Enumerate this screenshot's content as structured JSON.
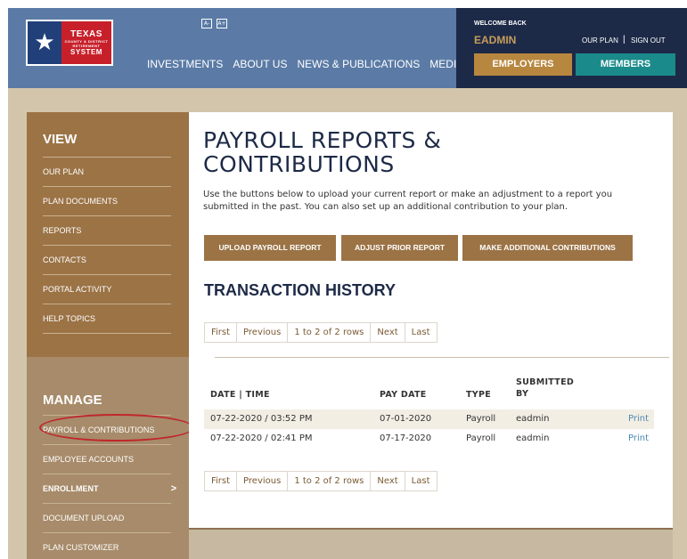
{
  "logo": {
    "line1": "TEXAS",
    "line2": "COUNTY & DISTRICT",
    "line3": "RETIREMENT",
    "line4": "SYSTEM",
    "star_icon": "star-icon"
  },
  "accessibility": {
    "decrease": "A-",
    "increase": "A+"
  },
  "nav": {
    "items": [
      "INVESTMENTS",
      "ABOUT US",
      "NEWS & PUBLICATIONS",
      "MEDIA"
    ]
  },
  "account": {
    "welcome": "WELCOME BACK",
    "username": "EADMIN",
    "our_plan": "OUR PLAN",
    "separator": "|",
    "sign_out": "SIGN OUT",
    "employers": "EMPLOYERS",
    "members": "MEMBERS"
  },
  "sidebar": {
    "view_heading": "VIEW",
    "view_items": [
      "OUR PLAN",
      "PLAN DOCUMENTS",
      "REPORTS",
      "CONTACTS",
      "PORTAL ACTIVITY",
      "HELP TOPICS"
    ],
    "manage_heading": "MANAGE",
    "manage_items": [
      "PAYROLL & CONTRIBUTIONS",
      "EMPLOYEE ACCOUNTS",
      "ENROLLMENT",
      "DOCUMENT UPLOAD",
      "PLAN CUSTOMIZER"
    ],
    "enrollment_chevron": ">"
  },
  "main": {
    "title": "PAYROLL REPORTS & CONTRIBUTIONS",
    "intro": "Use the buttons below to upload your current report or make an adjustment to a report you submitted in the past. You can also set up an additional contribution to your plan.",
    "buttons": [
      "UPLOAD PAYROLL REPORT",
      "ADJUST PRIOR REPORT",
      "MAKE ADDITIONAL CONTRIBUTIONS"
    ],
    "history_title": "TRANSACTION HISTORY",
    "pager": {
      "first": "First",
      "previous": "Previous",
      "range": "1 to 2 of 2 rows",
      "next": "Next",
      "last": "Last"
    },
    "table": {
      "headers": {
        "date_time": "DATE | TIME",
        "pay_date": "PAY DATE",
        "type": "TYPE",
        "submitted_by_1": "SUBMITTED",
        "submitted_by_2": "BY"
      },
      "rows": [
        {
          "date_time": "07-22-2020 / 03:52 PM",
          "pay_date": "07-01-2020",
          "type": "Payroll",
          "submitted_by": "eadmin",
          "action": "Print"
        },
        {
          "date_time": "07-22-2020 / 02:41 PM",
          "pay_date": "07-17-2020",
          "type": "Payroll",
          "submitted_by": "eadmin",
          "action": "Print"
        }
      ]
    }
  },
  "colors": {
    "header": "#5b7ba6",
    "account_bg": "#1d2a47",
    "brown": "#9b7345",
    "teal": "#1b8a8b",
    "gold": "#b8873f",
    "highlight_circle": "#c0272d",
    "link": "#4d8ab5"
  }
}
